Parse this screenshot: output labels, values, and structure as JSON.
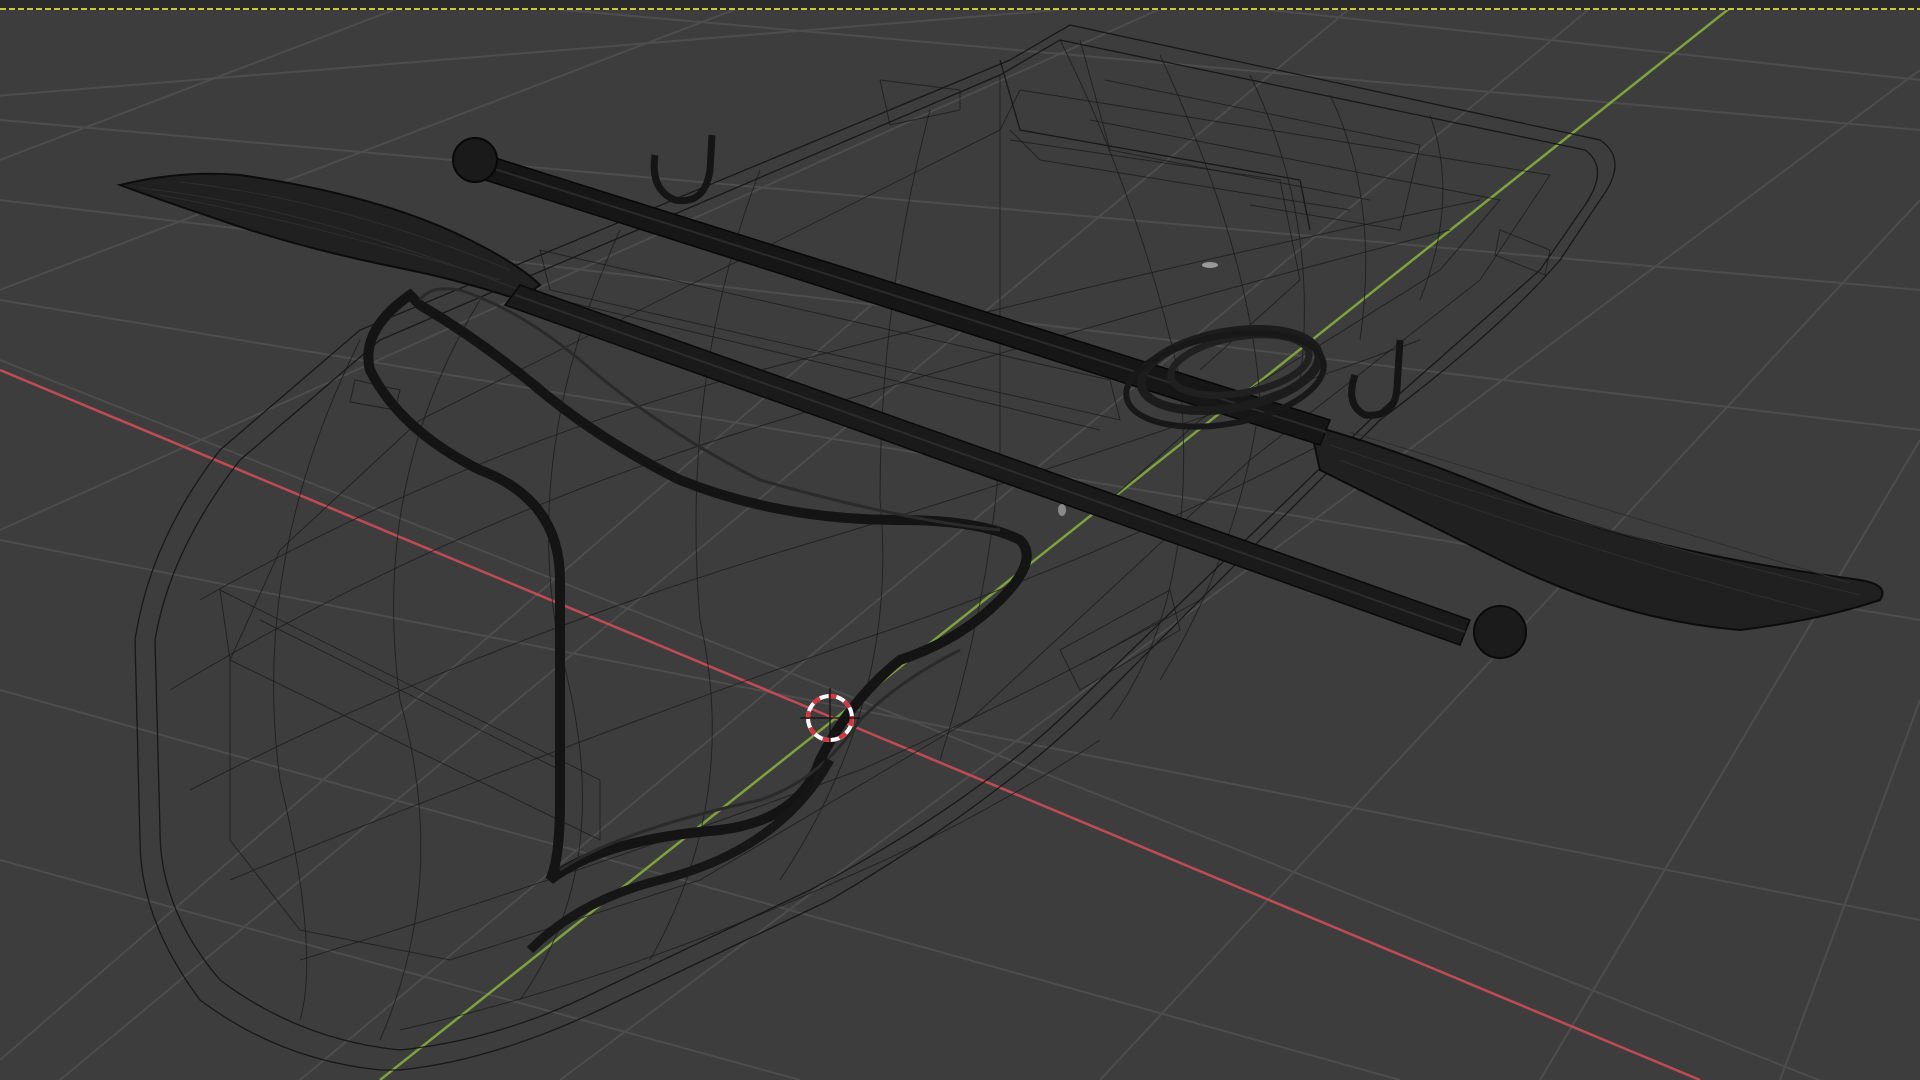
{
  "app": {
    "window": "3D Viewport",
    "shading": "wireframe"
  },
  "colors": {
    "background": "#3d3d3d",
    "grid": "#4d4d4d",
    "x_axis": "#c04b55",
    "y_axis": "#7da33b",
    "wire": "#141414",
    "top_border": "#c9c93a",
    "cursor_red": "#e0303a",
    "cursor_white": "#ffffff"
  },
  "scene": {
    "objects": [
      "boat-hull",
      "oar",
      "pole",
      "rope",
      "oarlock-left",
      "oarlock-right"
    ]
  }
}
